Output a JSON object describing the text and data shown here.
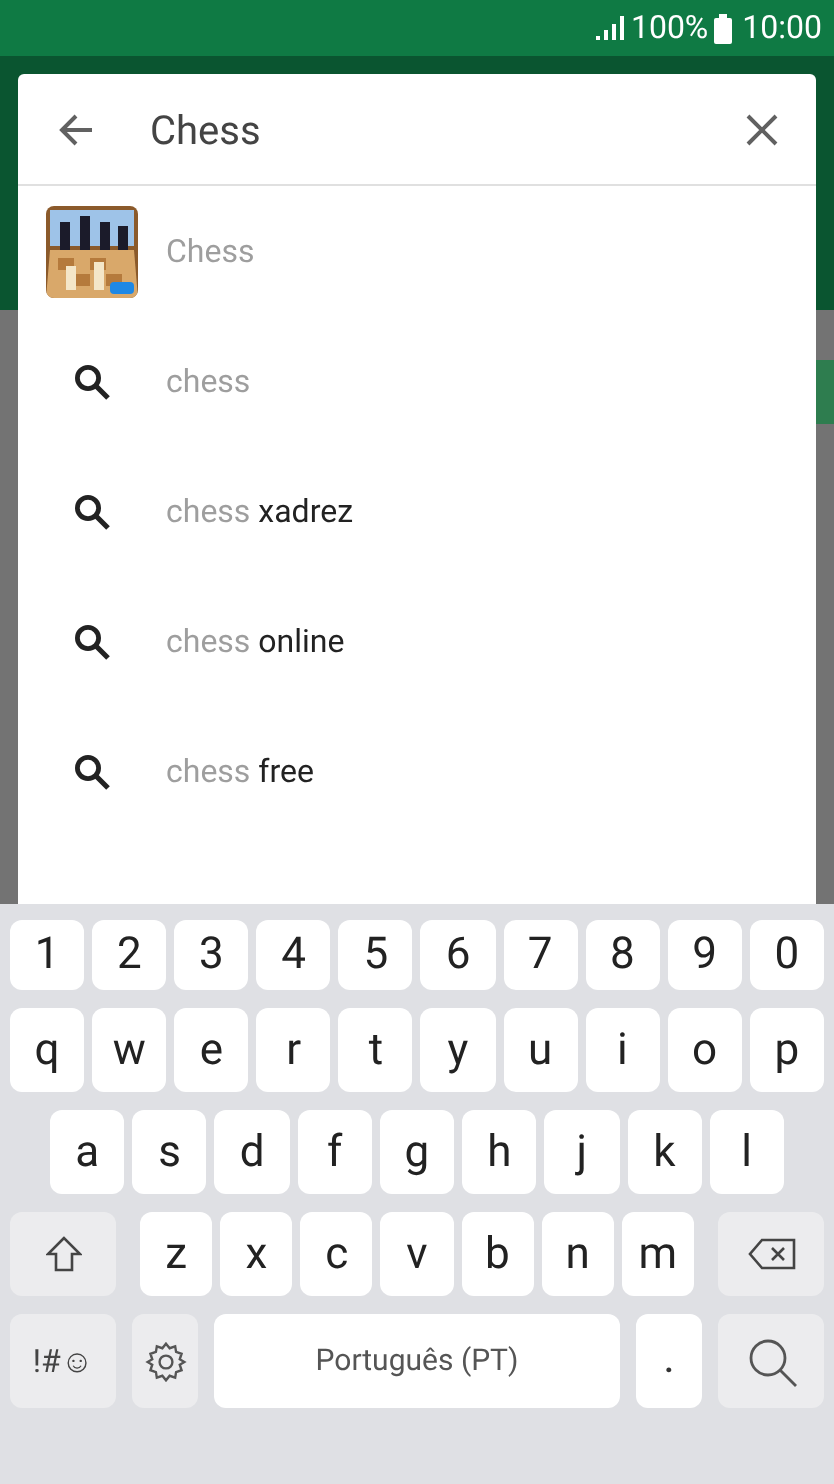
{
  "status_bar": {
    "battery": "100%",
    "time": "10:00"
  },
  "search": {
    "value": "Chess"
  },
  "suggestions": [
    {
      "kind": "app",
      "prefix": "Chess"
    },
    {
      "kind": "query",
      "prefix": "chess"
    },
    {
      "kind": "query",
      "prefix": "chess",
      "suffix": " xadrez"
    },
    {
      "kind": "query",
      "prefix": "chess",
      "suffix": " online"
    },
    {
      "kind": "query",
      "prefix": "chess",
      "suffix": " free"
    }
  ],
  "keyboard": {
    "number_row": [
      "1",
      "2",
      "3",
      "4",
      "5",
      "6",
      "7",
      "8",
      "9",
      "0"
    ],
    "letter_rows": [
      [
        "q",
        "w",
        "e",
        "r",
        "t",
        "y",
        "u",
        "i",
        "o",
        "p"
      ],
      [
        "a",
        "s",
        "d",
        "f",
        "g",
        "h",
        "j",
        "k",
        "l"
      ],
      [
        "z",
        "x",
        "c",
        "v",
        "b",
        "n",
        "m"
      ]
    ],
    "symbols_key": "!#☺",
    "space_label": "Português (PT)",
    "period_key": "."
  }
}
